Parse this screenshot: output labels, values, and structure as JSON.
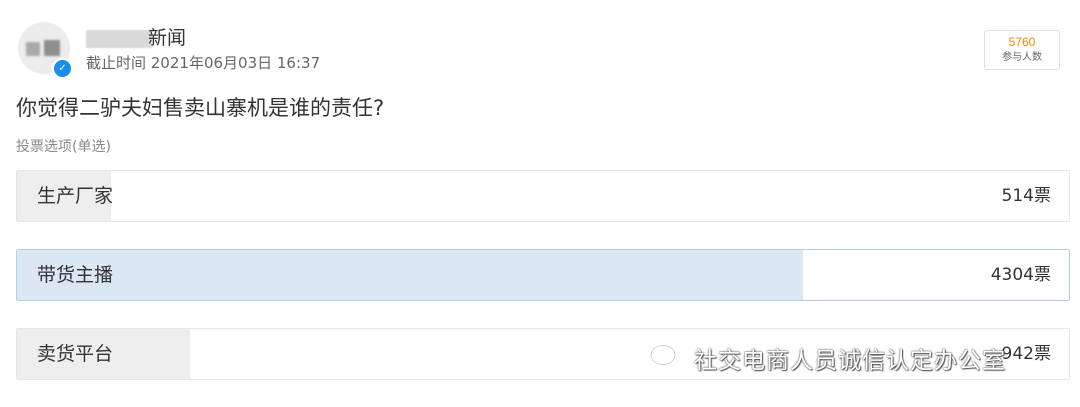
{
  "header": {
    "author_name": "新闻",
    "deadline": "截止时间 2021年06月03日 16:37",
    "participants_count": "5760",
    "participants_label": "参与人数",
    "verified_icon": "verified-badge-icon"
  },
  "poll": {
    "question": "你觉得二驴夫妇售卖山寨机是谁的责任?",
    "vote_type": "投票选项(单选)",
    "options": [
      {
        "label": "生产厂家",
        "count": "514票",
        "fraction": 0.089,
        "selected": false
      },
      {
        "label": "带货主播",
        "count": "4304票",
        "fraction": 0.747,
        "selected": true
      },
      {
        "label": "卖货平台",
        "count": "942票",
        "fraction": 0.164,
        "selected": false
      }
    ]
  },
  "watermark": {
    "text": "社交电商人员诚信认定办公室",
    "icon": "wechat-icon"
  },
  "colors": {
    "accent_orange": "#ff8200",
    "selected_fill": "#dbe7f3",
    "default_fill": "#eeeeee",
    "verified_blue": "#1a8ceb"
  }
}
